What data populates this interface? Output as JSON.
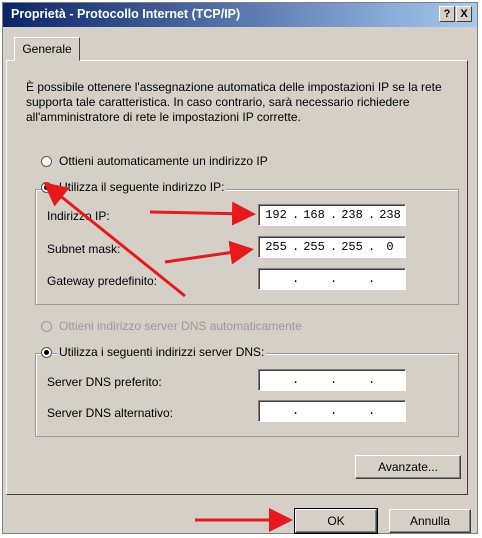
{
  "window": {
    "title": "Proprietà - Protocollo Internet (TCP/IP)",
    "help_label": "?",
    "close_label": "X"
  },
  "tab": {
    "label": "Generale"
  },
  "description": "È possibile ottenere l'assegnazione automatica delle impostazioni IP se la rete supporta tale caratteristica. In caso contrario, sarà necessario richiedere all'amministratore di rete le impostazioni IP corrette.",
  "ip_settings": {
    "auto_label": "Ottieni automaticamente un indirizzo IP",
    "manual_label": "Utilizza il seguente indirizzo IP:",
    "selected": "manual",
    "fields": [
      {
        "label": "Indirizzo IP:",
        "octets": [
          "192",
          "168",
          "238",
          "238"
        ]
      },
      {
        "label": "Subnet mask:",
        "octets": [
          "255",
          "255",
          "255",
          "0"
        ]
      },
      {
        "label": "Gateway predefinito:",
        "octets": [
          "",
          "",
          "",
          ""
        ]
      }
    ]
  },
  "dns_settings": {
    "auto_label": "Ottieni indirizzo server DNS automaticamente",
    "manual_label": "Utilizza i seguenti indirizzi server DNS:",
    "selected": "manual",
    "fields": [
      {
        "label": "Server DNS preferito:",
        "octets": [
          "",
          "",
          "",
          ""
        ]
      },
      {
        "label": "Server DNS alternativo:",
        "octets": [
          "",
          "",
          "",
          ""
        ]
      }
    ]
  },
  "buttons": {
    "advanced": "Avanzate...",
    "ok": "OK",
    "cancel": "Annulla"
  },
  "colors": {
    "titlebar_start": "#0a246a",
    "titlebar_end": "#a6caf0",
    "dialog_face": "#d4d0c8",
    "annotation_arrow": "#e8191c"
  },
  "icons": [
    "help-icon",
    "close-icon",
    "annotation-arrow"
  ]
}
